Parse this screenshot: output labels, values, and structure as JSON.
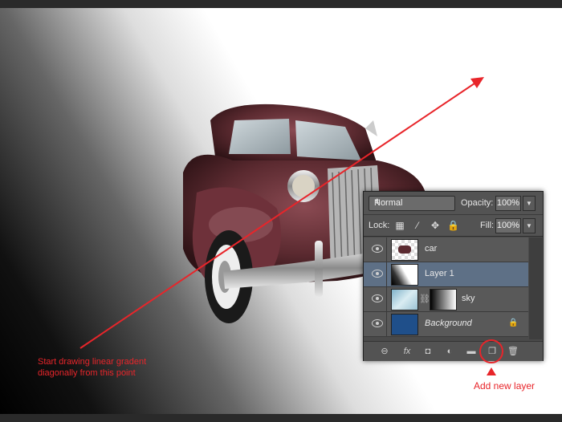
{
  "annotations": {
    "start_line1": "Start drawing linear gradent",
    "start_line2": "diagonally from this point",
    "add_layer": "Add new layer",
    "color": "#e8252a"
  },
  "layers_panel": {
    "blend_mode": "Normal",
    "opacity_label": "Opacity:",
    "opacity_value": "100%",
    "lock_label": "Lock:",
    "fill_label": "Fill:",
    "fill_value": "100%",
    "layers": [
      {
        "name": "car",
        "selected": false,
        "icon": "car-thumbnail"
      },
      {
        "name": "Layer 1",
        "selected": true,
        "icon": "gradient-thumbnail"
      },
      {
        "name": "sky",
        "selected": false,
        "icon": "sky-thumbnail"
      },
      {
        "name": "Background",
        "selected": false,
        "icon": "background-thumbnail",
        "locked": true
      }
    ],
    "footer_icons": [
      "link-icon",
      "fx-icon",
      "mask-icon",
      "adjustment-icon",
      "folder-icon",
      "new-layer-icon",
      "trash-icon"
    ],
    "fx_label": "fx"
  }
}
